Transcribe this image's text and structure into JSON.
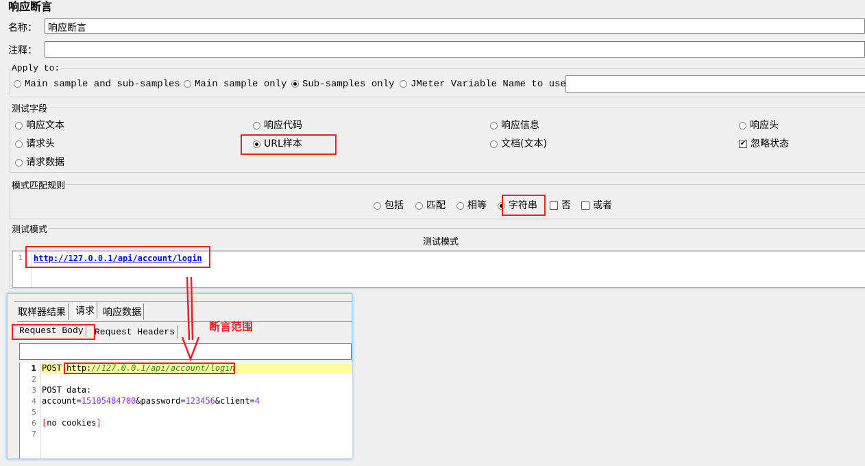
{
  "title": "响应断言",
  "name": {
    "label": "名称：",
    "value": "响应断言"
  },
  "comment": {
    "label": "注释：",
    "value": ""
  },
  "apply_to": {
    "legend": "Apply to:",
    "options": [
      "Main sample and sub-samples",
      "Main sample only",
      "Sub-samples only",
      "JMeter Variable Name to use"
    ],
    "selected": 2,
    "variable_value": ""
  },
  "test_field": {
    "legend": "测试字段",
    "options": [
      "响应文本",
      "响应代码",
      "响应信息",
      "响应头",
      "请求头",
      "URL样本",
      "文档(文本)",
      "请求数据"
    ],
    "selected": "URL样本",
    "ignore_status": {
      "label": "忽略状态",
      "checked": true
    }
  },
  "match_rules": {
    "legend": "模式匹配规则",
    "options": [
      "包括",
      "匹配",
      "相等",
      "字符串"
    ],
    "selected": "字符串",
    "not_label": "否",
    "or_label": "或者"
  },
  "test_patterns": {
    "legend": "测试模式",
    "column_header": "测试模式",
    "rows": [
      {
        "num": "1",
        "value": "http://127.0.0.1/api/account/login"
      }
    ]
  },
  "annotation": "断言范围",
  "result_panel": {
    "tabs": [
      "取样器结果",
      "请求",
      "响应数据"
    ],
    "active_tab": "请求",
    "subtabs": [
      "Request Body",
      "Request Headers"
    ],
    "lines": [
      {
        "n": "1",
        "method": "POST",
        "url_prefix": "http:",
        "url_rest": "//127.0.0.1/api/account/login"
      },
      {
        "n": "2"
      },
      {
        "n": "3",
        "text": "POST data:"
      },
      {
        "n": "4",
        "k1": "account",
        "v1": "15105484700",
        "k2": "password",
        "v2": "123456",
        "k3": "client",
        "v3": "4"
      },
      {
        "n": "5"
      },
      {
        "n": "6",
        "text": "no cookies"
      },
      {
        "n": "7"
      }
    ]
  }
}
